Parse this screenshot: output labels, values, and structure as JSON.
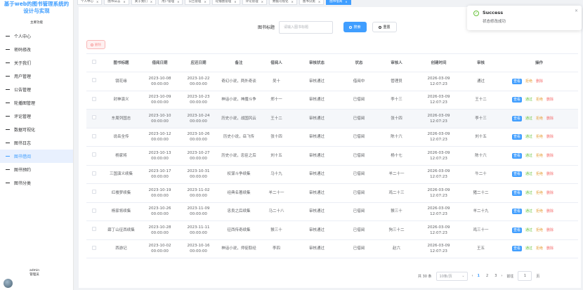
{
  "sidebar": {
    "title": "基于web的图书管理系统的设计与实现",
    "nav_heading": "主要功能",
    "items": [
      {
        "label": "个人中心"
      },
      {
        "label": "密码修改"
      },
      {
        "label": "关于我们"
      },
      {
        "label": "用户管理"
      },
      {
        "label": "公告管理"
      },
      {
        "label": "轮播图管理"
      },
      {
        "label": "评论管理"
      },
      {
        "label": "数据可视化"
      },
      {
        "label": "图书日志"
      },
      {
        "label": "图书借阅"
      },
      {
        "label": "图书预约"
      },
      {
        "label": "图书分类"
      }
    ],
    "active_index": 9,
    "user_line1": "admin",
    "user_line2": "管理员"
  },
  "tabs": [
    {
      "label": "个人中心"
    },
    {
      "label": "图书日志"
    },
    {
      "label": "关于我们"
    },
    {
      "label": "用户管理"
    },
    {
      "label": "公告管理"
    },
    {
      "label": "轮播图管理"
    },
    {
      "label": "评论管理"
    },
    {
      "label": "数据可视化"
    },
    {
      "label": "图书分类"
    },
    {
      "label": "图书借阅"
    }
  ],
  "active_tab": 9,
  "search": {
    "label": "图书标题",
    "placeholder": "请输入图书标题",
    "search_btn": "搜索",
    "reset_btn": "重置"
  },
  "batch_delete": "删除",
  "table": {
    "headers": [
      "图书标题",
      "借阅日期",
      "应还日期",
      "备注",
      "借阅人",
      "审核状态",
      "状态",
      "审核人",
      "创建时间",
      "审核",
      "操作"
    ],
    "rows": [
      {
        "title": "镜花缘",
        "borrow": [
          "2023-10-08",
          "00:00:00"
        ],
        "due": [
          "2023-10-22",
          "00:00:00"
        ],
        "note": "奇幻小说，两外奇谈",
        "borrower": "吴十",
        "audit_status": "审核通过",
        "status": "借阅中",
        "auditor": "管理员",
        "created": [
          "2026-03-09",
          "12:07:23"
        ],
        "audit": "通过",
        "ops": [
          "查看",
          "拒绝",
          "删除"
        ]
      },
      {
        "title": "封神演义",
        "borrow": [
          "2023-10-09",
          "00:00:00"
        ],
        "due": [
          "2023-10-23",
          "00:00:00"
        ],
        "note": "神话小说，神魔斗争",
        "borrower": "郑十一",
        "audit_status": "审核通过",
        "status": "已借阅",
        "auditor": "李十三",
        "created": [
          "2026-03-09",
          "12:07:23"
        ],
        "audit": "王十二",
        "ops": [
          "查看",
          "通过",
          "拒绝",
          "删除"
        ]
      },
      {
        "title": "东周列国志",
        "borrow": [
          "2023-10-10",
          "00:00:00"
        ],
        "due": [
          "2023-10-24",
          "00:00:00"
        ],
        "note": "历史小说，战国风云",
        "borrower": "王十二",
        "audit_status": "审核通过",
        "status": "已借阅",
        "auditor": "张十四",
        "created": [
          "2026-03-09",
          "12:07:23"
        ],
        "audit": "李十三",
        "ops": [
          "查看",
          "通过",
          "拒绝",
          "删除"
        ]
      },
      {
        "title": "说岳全传",
        "borrow": [
          "2023-10-12",
          "00:00:00"
        ],
        "due": [
          "2023-10-26",
          "00:00:00"
        ],
        "note": "历史小说，岳飞传",
        "borrower": "张十四",
        "audit_status": "审核通过",
        "status": "已借阅",
        "auditor": "陈十六",
        "created": [
          "2026-03-09",
          "12:07:23"
        ],
        "audit": "刘十五",
        "ops": [
          "查看",
          "通过",
          "拒绝",
          "删除"
        ]
      },
      {
        "title": "杨家将",
        "borrow": [
          "2023-10-13",
          "00:00:00"
        ],
        "due": [
          "2023-10-27",
          "00:00:00"
        ],
        "note": "历史小说，忠臣之后",
        "borrower": "刘十五",
        "audit_status": "审核通过",
        "status": "已借阅",
        "auditor": "杨十七",
        "created": [
          "2026-03-09",
          "12:07:23"
        ],
        "audit": "陈十六",
        "ops": [
          "查看",
          "通过",
          "拒绝",
          "删除"
        ]
      },
      {
        "title": "三国演义续集",
        "borrow": [
          "2023-10-17",
          "00:00:00"
        ],
        "due": [
          "2023-10-31",
          "00:00:00"
        ],
        "note": "权谋斗争续集",
        "borrower": "马十九",
        "audit_status": "审核通过",
        "status": "已借阅",
        "auditor": "羊二十一",
        "created": [
          "2026-03-09",
          "12:07:23"
        ],
        "audit": "牛二十",
        "ops": [
          "查看",
          "通过",
          "拒绝",
          "删除"
        ]
      },
      {
        "title": "红楼梦续集",
        "borrow": [
          "2023-10-19",
          "00:00:00"
        ],
        "due": [
          "2023-11-02",
          "00:00:00"
        ],
        "note": "经典名著续集",
        "borrower": "羊二十一",
        "audit_status": "审核通过",
        "status": "已借阅",
        "auditor": "鸡二十三",
        "created": [
          "2026-03-09",
          "12:07:23"
        ],
        "audit": "猪二十二",
        "ops": [
          "查看",
          "通过",
          "拒绝",
          "删除"
        ]
      },
      {
        "title": "杨家将续集",
        "borrow": [
          "2023-10-26",
          "00:00:00"
        ],
        "due": [
          "2023-11-09",
          "00:00:00"
        ],
        "note": "忠良之后续集",
        "borrower": "马二十八",
        "audit_status": "审核通过",
        "status": "已借阅",
        "auditor": "猴三十",
        "created": [
          "2026-03-09",
          "12:07:23"
        ],
        "audit": "羊二十九",
        "ops": [
          "查看",
          "通过",
          "拒绝",
          "删除"
        ]
      },
      {
        "title": "薛丁山征西续集",
        "borrow": [
          "2023-10-28",
          "00:00:00"
        ],
        "due": [
          "2023-11-11",
          "00:00:00"
        ],
        "note": "征西传奇续集",
        "borrower": "猴三十",
        "audit_status": "审核通过",
        "status": "已借阅",
        "auditor": "狗三十二",
        "created": [
          "2026-03-09",
          "12:07:23"
        ],
        "audit": "鸡三十一",
        "ops": [
          "查看",
          "通过",
          "拒绝",
          "删除"
        ]
      },
      {
        "title": "西游记",
        "borrow": [
          "2023-10-02",
          "00:00:00"
        ],
        "due": [
          "2023-10-16",
          "00:00:00"
        ],
        "note": "神话小说，师徒取经",
        "borrower": "李四",
        "audit_status": "审核通过",
        "status": "已借阅",
        "auditor": "赵六",
        "created": [
          "2026-03-09",
          "12:07:23"
        ],
        "audit": "王五",
        "ops": [
          "查看",
          "通过",
          "拒绝",
          "删除"
        ]
      }
    ]
  },
  "pager": {
    "total": "共 30 条",
    "page_size": "10条/页",
    "pages": [
      "1",
      "2",
      "3"
    ],
    "current": "1",
    "prev": "‹",
    "next": "›",
    "goto": "前往",
    "goto_value": "1",
    "page_suffix": "页"
  },
  "toast": {
    "title": "Success",
    "message": "状态修改成功",
    "close": "×"
  },
  "colors": {
    "primary": "#409eff",
    "success": "#67c23a",
    "warning": "#e6a23c",
    "danger": "#f56c6c"
  }
}
